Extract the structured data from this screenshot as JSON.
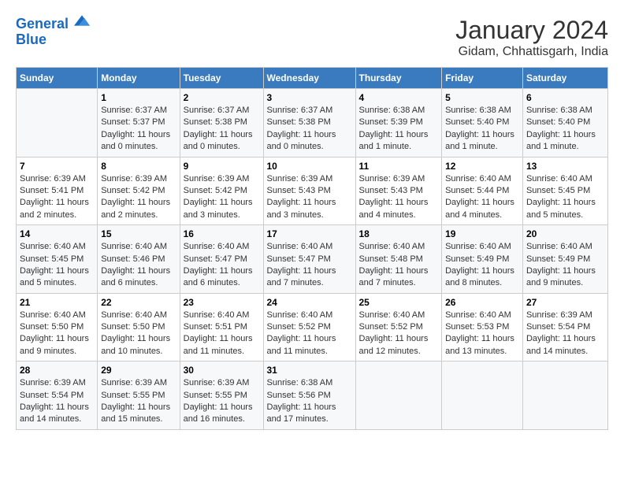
{
  "header": {
    "logo_line1": "General",
    "logo_line2": "Blue",
    "title": "January 2024",
    "subtitle": "Gidam, Chhattisgarh, India"
  },
  "days_of_week": [
    "Sunday",
    "Monday",
    "Tuesday",
    "Wednesday",
    "Thursday",
    "Friday",
    "Saturday"
  ],
  "weeks": [
    [
      {
        "num": "",
        "info": ""
      },
      {
        "num": "1",
        "info": "Sunrise: 6:37 AM\nSunset: 5:37 PM\nDaylight: 11 hours and 0 minutes."
      },
      {
        "num": "2",
        "info": "Sunrise: 6:37 AM\nSunset: 5:38 PM\nDaylight: 11 hours and 0 minutes."
      },
      {
        "num": "3",
        "info": "Sunrise: 6:37 AM\nSunset: 5:38 PM\nDaylight: 11 hours and 0 minutes."
      },
      {
        "num": "4",
        "info": "Sunrise: 6:38 AM\nSunset: 5:39 PM\nDaylight: 11 hours and 1 minute."
      },
      {
        "num": "5",
        "info": "Sunrise: 6:38 AM\nSunset: 5:40 PM\nDaylight: 11 hours and 1 minute."
      },
      {
        "num": "6",
        "info": "Sunrise: 6:38 AM\nSunset: 5:40 PM\nDaylight: 11 hours and 1 minute."
      }
    ],
    [
      {
        "num": "7",
        "info": "Sunrise: 6:39 AM\nSunset: 5:41 PM\nDaylight: 11 hours and 2 minutes."
      },
      {
        "num": "8",
        "info": "Sunrise: 6:39 AM\nSunset: 5:42 PM\nDaylight: 11 hours and 2 minutes."
      },
      {
        "num": "9",
        "info": "Sunrise: 6:39 AM\nSunset: 5:42 PM\nDaylight: 11 hours and 3 minutes."
      },
      {
        "num": "10",
        "info": "Sunrise: 6:39 AM\nSunset: 5:43 PM\nDaylight: 11 hours and 3 minutes."
      },
      {
        "num": "11",
        "info": "Sunrise: 6:39 AM\nSunset: 5:43 PM\nDaylight: 11 hours and 4 minutes."
      },
      {
        "num": "12",
        "info": "Sunrise: 6:40 AM\nSunset: 5:44 PM\nDaylight: 11 hours and 4 minutes."
      },
      {
        "num": "13",
        "info": "Sunrise: 6:40 AM\nSunset: 5:45 PM\nDaylight: 11 hours and 5 minutes."
      }
    ],
    [
      {
        "num": "14",
        "info": "Sunrise: 6:40 AM\nSunset: 5:45 PM\nDaylight: 11 hours and 5 minutes."
      },
      {
        "num": "15",
        "info": "Sunrise: 6:40 AM\nSunset: 5:46 PM\nDaylight: 11 hours and 6 minutes."
      },
      {
        "num": "16",
        "info": "Sunrise: 6:40 AM\nSunset: 5:47 PM\nDaylight: 11 hours and 6 minutes."
      },
      {
        "num": "17",
        "info": "Sunrise: 6:40 AM\nSunset: 5:47 PM\nDaylight: 11 hours and 7 minutes."
      },
      {
        "num": "18",
        "info": "Sunrise: 6:40 AM\nSunset: 5:48 PM\nDaylight: 11 hours and 7 minutes."
      },
      {
        "num": "19",
        "info": "Sunrise: 6:40 AM\nSunset: 5:49 PM\nDaylight: 11 hours and 8 minutes."
      },
      {
        "num": "20",
        "info": "Sunrise: 6:40 AM\nSunset: 5:49 PM\nDaylight: 11 hours and 9 minutes."
      }
    ],
    [
      {
        "num": "21",
        "info": "Sunrise: 6:40 AM\nSunset: 5:50 PM\nDaylight: 11 hours and 9 minutes."
      },
      {
        "num": "22",
        "info": "Sunrise: 6:40 AM\nSunset: 5:50 PM\nDaylight: 11 hours and 10 minutes."
      },
      {
        "num": "23",
        "info": "Sunrise: 6:40 AM\nSunset: 5:51 PM\nDaylight: 11 hours and 11 minutes."
      },
      {
        "num": "24",
        "info": "Sunrise: 6:40 AM\nSunset: 5:52 PM\nDaylight: 11 hours and 11 minutes."
      },
      {
        "num": "25",
        "info": "Sunrise: 6:40 AM\nSunset: 5:52 PM\nDaylight: 11 hours and 12 minutes."
      },
      {
        "num": "26",
        "info": "Sunrise: 6:40 AM\nSunset: 5:53 PM\nDaylight: 11 hours and 13 minutes."
      },
      {
        "num": "27",
        "info": "Sunrise: 6:39 AM\nSunset: 5:54 PM\nDaylight: 11 hours and 14 minutes."
      }
    ],
    [
      {
        "num": "28",
        "info": "Sunrise: 6:39 AM\nSunset: 5:54 PM\nDaylight: 11 hours and 14 minutes."
      },
      {
        "num": "29",
        "info": "Sunrise: 6:39 AM\nSunset: 5:55 PM\nDaylight: 11 hours and 15 minutes."
      },
      {
        "num": "30",
        "info": "Sunrise: 6:39 AM\nSunset: 5:55 PM\nDaylight: 11 hours and 16 minutes."
      },
      {
        "num": "31",
        "info": "Sunrise: 6:38 AM\nSunset: 5:56 PM\nDaylight: 11 hours and 17 minutes."
      },
      {
        "num": "",
        "info": ""
      },
      {
        "num": "",
        "info": ""
      },
      {
        "num": "",
        "info": ""
      }
    ]
  ]
}
